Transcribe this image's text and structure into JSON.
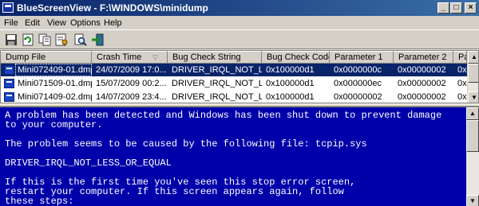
{
  "window": {
    "title": "BlueScreenView  -  F:\\WINDOWS\\minidump",
    "minimize_label": "_",
    "maximize_label": "□",
    "close_label": "×"
  },
  "menu": [
    "File",
    "Edit",
    "View",
    "Options",
    "Help"
  ],
  "toolbar": {
    "icons": [
      "save-icon",
      "refresh-icon",
      "copy-icon",
      "properties-icon",
      "find-icon",
      "exit-icon"
    ]
  },
  "table": {
    "columns": [
      "Dump File",
      "Crash Time",
      "Bug Check String",
      "Bug Check Code",
      "Parameter 1",
      "Parameter 2",
      "Pa"
    ],
    "sort_indicator": "▽",
    "rows": [
      [
        "Mini072409-01.dmp",
        "24/07/2009 17:0...",
        "DRIVER_IRQL_NOT_L...",
        "0x100000d1",
        "0x0000000c",
        "0x00000002",
        "0x"
      ],
      [
        "Mini071509-01.dmp",
        "15/07/2009 00:2...",
        "DRIVER_IRQL_NOT_L...",
        "0x100000d1",
        "0x000000ec",
        "0x00000002",
        "0x"
      ],
      [
        "Mini071409-02.dmp",
        "14/07/2009 23:4...",
        "DRIVER_IRQL_NOT_L...",
        "0x100000d1",
        "0x00000002",
        "0x00000002",
        "0x"
      ]
    ],
    "selected_row": 0
  },
  "bsod": {
    "lines": [
      "A problem has been detected and Windows has been shut down to prevent damage",
      "to your computer.",
      "",
      "The problem seems to be caused by the following file: tcpip.sys",
      "",
      "DRIVER_IRQL_NOT_LESS_OR_EQUAL",
      "",
      "If this is the first time you've seen this stop error screen,",
      "restart your computer. If this screen appears again, follow",
      "these steps:"
    ]
  },
  "scroll": {
    "up": "▲",
    "down": "▼"
  },
  "colors": {
    "bsod_background": "#0000aa",
    "selection": "#0a246a",
    "title_gradient_start": "#0a246a"
  }
}
